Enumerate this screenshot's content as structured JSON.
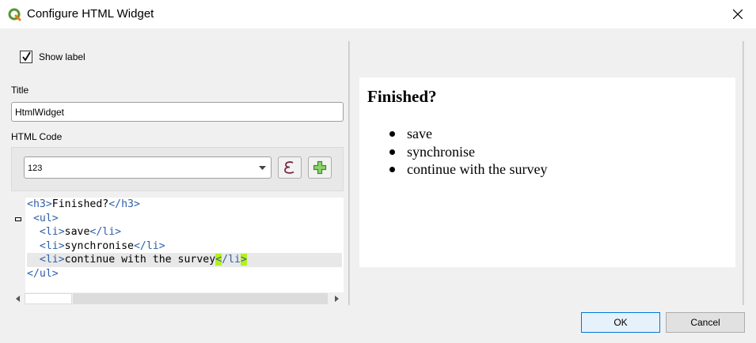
{
  "window": {
    "title": "Configure HTML Widget",
    "icon": "qgis-logo-icon"
  },
  "form": {
    "show_label": {
      "label": "Show label",
      "checked": true
    },
    "title_label": "Title",
    "title_value": "HtmlWidget",
    "html_code_label": "HTML Code",
    "expression_combo_value": "123"
  },
  "code": {
    "lines": [
      {
        "parts": [
          {
            "t": "<h3>",
            "c": "tag"
          },
          {
            "t": "Finished?",
            "c": "txt"
          },
          {
            "t": "</h3>",
            "c": "tag"
          }
        ]
      },
      {
        "parts": [
          {
            "t": " <ul>",
            "c": "tag"
          }
        ]
      },
      {
        "parts": [
          {
            "t": "  <li>",
            "c": "tag"
          },
          {
            "t": "save",
            "c": "txt"
          },
          {
            "t": "</li>",
            "c": "tag"
          }
        ]
      },
      {
        "parts": [
          {
            "t": "  <li>",
            "c": "tag"
          },
          {
            "t": "synchronise",
            "c": "txt"
          },
          {
            "t": "</li>",
            "c": "tag"
          }
        ]
      },
      {
        "current": true,
        "parts": [
          {
            "t": "  <li>",
            "c": "tag"
          },
          {
            "t": "continue with the survey",
            "c": "txt"
          },
          {
            "t": "<",
            "c": "tag hl"
          },
          {
            "t": "/li",
            "c": "tag"
          },
          {
            "t": ">",
            "c": "tag hl"
          }
        ]
      },
      {
        "parts": [
          {
            "t": "</ul>",
            "c": "tag"
          }
        ]
      }
    ]
  },
  "preview": {
    "heading": "Finished?",
    "items": [
      "save",
      "synchronise",
      "continue with the survey"
    ]
  },
  "buttons": {
    "ok": "OK",
    "cancel": "Cancel"
  },
  "colors": {
    "tag": "#3060a8",
    "bracket_highlight": "#b6f018",
    "ok_border": "#0078d7"
  }
}
